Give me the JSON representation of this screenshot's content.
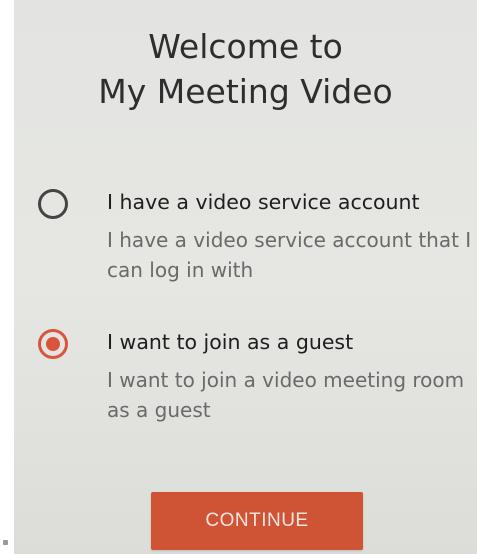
{
  "screen": {
    "title_line1": "Welcome to",
    "title_line2": "My Meeting Video"
  },
  "options": [
    {
      "title": "I have a video service account",
      "description": "I have a video service account that I can log in with",
      "selected": false
    },
    {
      "title": "I want to join as a guest",
      "description": "I want to join a video meeting room as a guest",
      "selected": true
    }
  ],
  "actions": {
    "continue_label": "CONTINUE"
  },
  "colors": {
    "accent": "#d9543d",
    "background": "#e4e5e1",
    "button": "#cf5335"
  }
}
